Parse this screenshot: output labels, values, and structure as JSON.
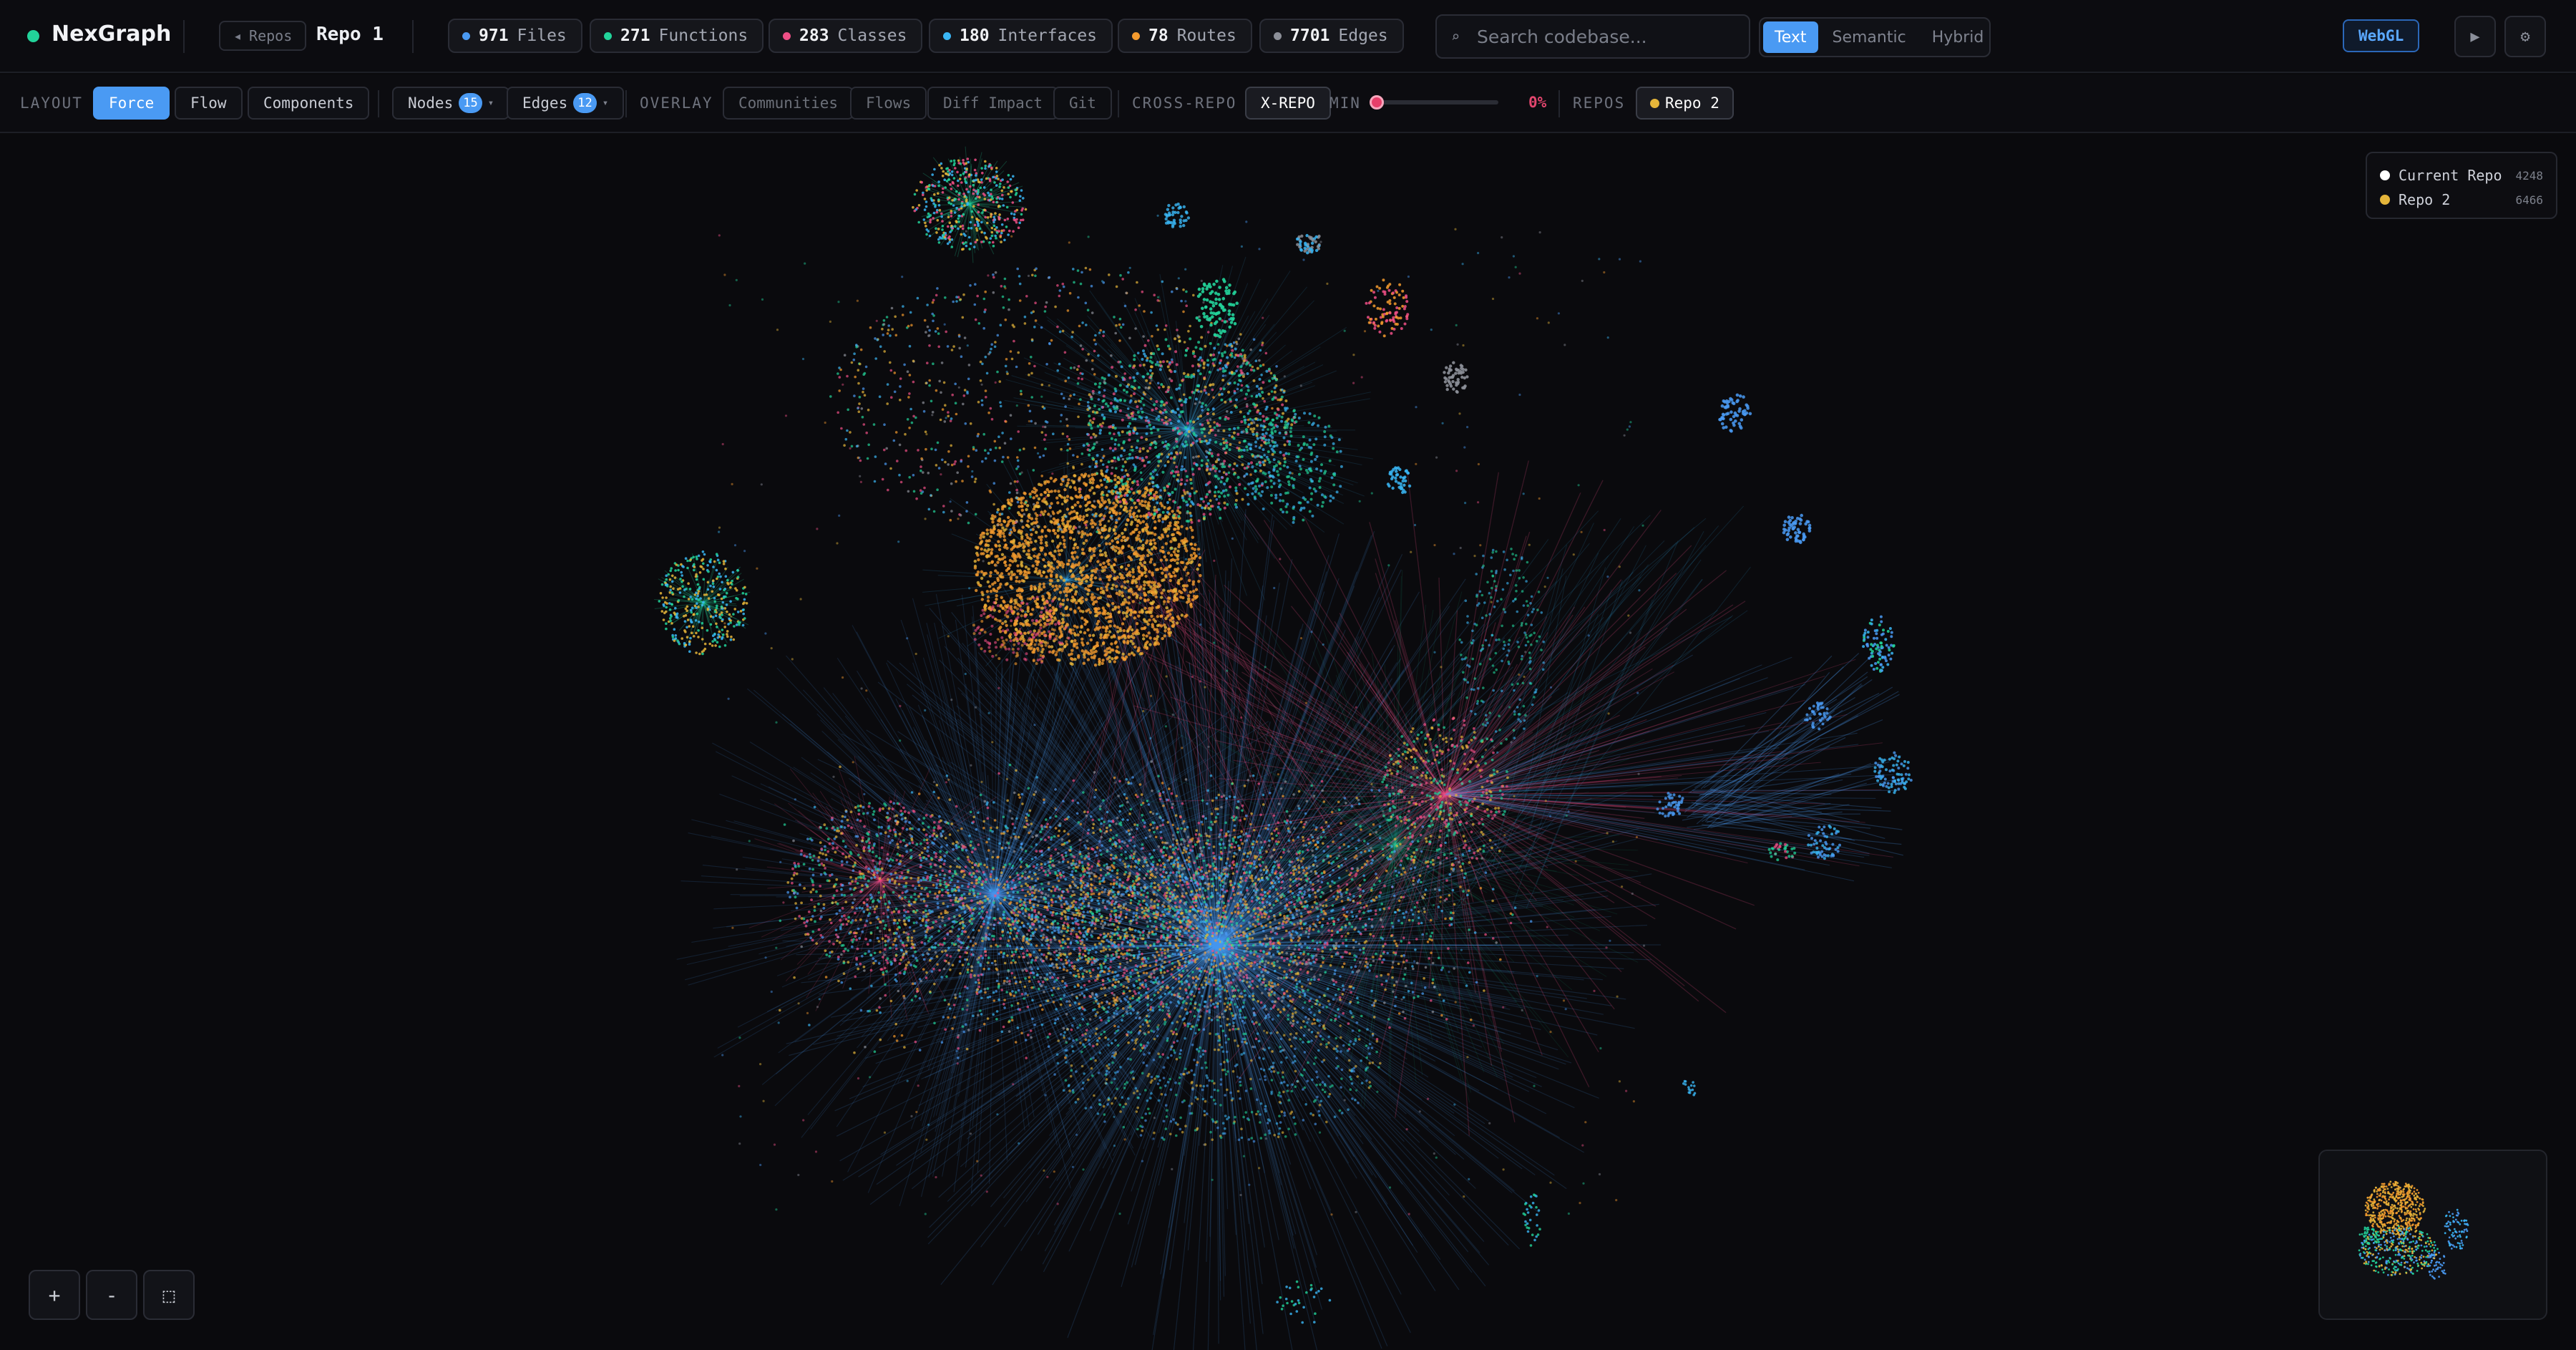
{
  "app": {
    "name": "NexGraph",
    "status_color": "#22d39a"
  },
  "header": {
    "back_label": "Repos",
    "back_icon": "◂",
    "repo_name": "Repo 1",
    "stats": [
      {
        "count": "971",
        "label": "Files",
        "color": "#4a9af3"
      },
      {
        "count": "271",
        "label": "Functions",
        "color": "#22d39a"
      },
      {
        "count": "283",
        "label": "Classes",
        "color": "#ee4f86"
      },
      {
        "count": "180",
        "label": "Interfaces",
        "color": "#3ab6f5"
      },
      {
        "count": "78",
        "label": "Routes",
        "color": "#f39a2e"
      },
      {
        "count": "7701",
        "label": "Edges",
        "color": "#8c8f98"
      }
    ],
    "search": {
      "placeholder": "Search codebase...",
      "value": "",
      "icon": "⌕"
    },
    "search_modes": [
      "Text",
      "Semantic",
      "Hybrid"
    ],
    "search_mode_selected": "Text",
    "renderer": "WebGL",
    "play_icon": "▶",
    "settings_icon": "⚙"
  },
  "toolbar": {
    "layout_label": "LAYOUT",
    "layouts": [
      "Force",
      "Flow",
      "Components"
    ],
    "layout_selected": "Force",
    "nodes": {
      "label": "Nodes",
      "badge": "15",
      "caret": "▾"
    },
    "edges": {
      "label": "Edges",
      "badge": "12",
      "caret": "▾"
    },
    "overlay_label": "OVERLAY",
    "overlays": [
      "Communities",
      "Flows",
      "Diff Impact",
      "Git"
    ],
    "cross_repo_label": "CROSS-REPO",
    "xrepo_button": "X-REPO",
    "min_label": "MIN",
    "min_value": "0%",
    "min_fraction": 0.0,
    "repos_label": "REPOS",
    "repo_chip": {
      "label": "Repo 2",
      "color": "#e5b53a"
    }
  },
  "legend": [
    {
      "label": "Current Repo",
      "count": "4248",
      "color": "#ffffff"
    },
    {
      "label": "Repo 2",
      "count": "6466",
      "color": "#e5b53a"
    }
  ],
  "zoom": {
    "in": "+",
    "out": "-",
    "fit": "⬚"
  },
  "palette": {
    "blue": "#4a9af3",
    "green": "#22d39a",
    "pink": "#ee4f86",
    "orange": "#f39a2e",
    "yellow": "#e5b53a",
    "teal": "#3ab6f5",
    "gray": "#8c8f98"
  }
}
